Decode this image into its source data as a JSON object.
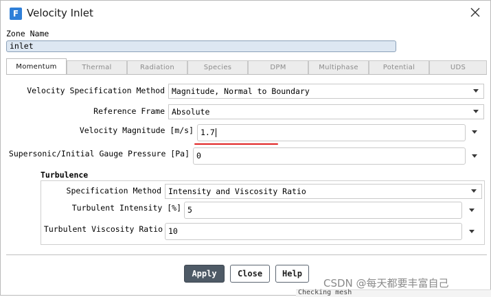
{
  "dialog": {
    "title": "Velocity Inlet",
    "app_icon_letter": "F"
  },
  "zone": {
    "label": "Zone Name",
    "value": "inlet"
  },
  "tabs": [
    {
      "label": "Momentum",
      "active": true
    },
    {
      "label": "Thermal",
      "active": false
    },
    {
      "label": "Radiation",
      "active": false
    },
    {
      "label": "Species",
      "active": false
    },
    {
      "label": "DPM",
      "active": false
    },
    {
      "label": "Multiphase",
      "active": false
    },
    {
      "label": "Potential",
      "active": false
    },
    {
      "label": "UDS",
      "active": false
    }
  ],
  "momentum": {
    "velocity_spec": {
      "label": "Velocity Specification Method",
      "value": "Magnitude, Normal to Boundary"
    },
    "reference_frame": {
      "label": "Reference Frame",
      "value": "Absolute"
    },
    "velocity_magnitude": {
      "label": "Velocity Magnitude [m/s]",
      "value": "1.7"
    },
    "gauge_pressure": {
      "label": "Supersonic/Initial Gauge Pressure [Pa]",
      "value": "0"
    }
  },
  "turbulence": {
    "title": "Turbulence",
    "spec_method": {
      "label": "Specification Method",
      "value": "Intensity and Viscosity Ratio"
    },
    "intensity": {
      "label": "Turbulent Intensity [%]",
      "value": "5"
    },
    "viscosity_ratio": {
      "label": "Turbulent Viscosity Ratio",
      "value": "10"
    }
  },
  "buttons": {
    "apply": "Apply",
    "close": "Close",
    "help": "Help"
  },
  "colors": {
    "primary_button": "#4e5a66",
    "annotation_underline": "#e02020",
    "app_icon": "#2f7fd8"
  },
  "watermark": "CSDN @每天都要丰富自己",
  "background_text": "Checking mesh"
}
